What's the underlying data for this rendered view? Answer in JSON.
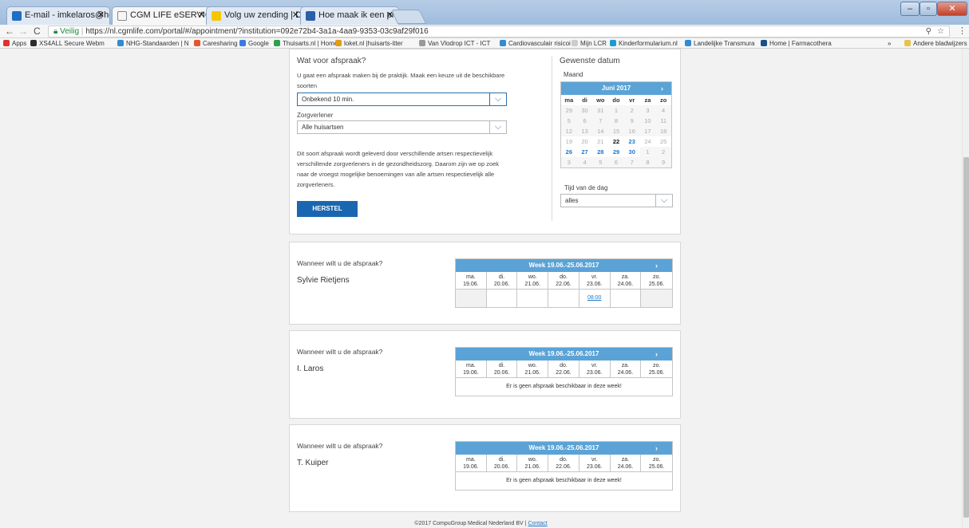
{
  "browser": {
    "tabs": [
      {
        "title": "E-mail - imkelaros@hotr",
        "color": "#1e6fc4"
      },
      {
        "title": "CGM LIFE eSERVICES",
        "color": "#888888"
      },
      {
        "title": "Volg uw zending | DHL F",
        "color": "#f6c700"
      },
      {
        "title": "Hoe maak ik een printsc",
        "color": "#2a5ea8"
      }
    ],
    "secure_label": "Veilig",
    "url": "https://nl.cgmlife.com/portal/#/appointment/?institution=092e72b4-3a1a-4aa9-9353-03c9af29f016",
    "bookmarks": [
      {
        "label": "Apps",
        "color": "#d33"
      },
      {
        "label": "XS4ALL Secure Webm",
        "color": "#2d2d2d"
      },
      {
        "label": "NHG-Standaarden | N",
        "color": "#2e8bd6"
      },
      {
        "label": "Caresharing",
        "color": "#e4572e"
      },
      {
        "label": "Google",
        "color": "#3b7be0"
      },
      {
        "label": "Thuisarts.nl | Home",
        "color": "#2aa24c"
      },
      {
        "label": "loket.nl |huisarts-itter",
        "color": "#e29c16"
      },
      {
        "label": "Van Vlodrop ICT - ICT",
        "color": "#999999"
      },
      {
        "label": "Cardiovasculair risicoi",
        "color": "#2e8bd6"
      },
      {
        "label": "Mijn LCR",
        "color": "#cccccc"
      },
      {
        "label": "Kinderformularium.nl",
        "color": "#1a9bd8"
      },
      {
        "label": "Landelijke Transmura",
        "color": "#2e8bd6"
      },
      {
        "label": "Home | Farmacothera",
        "color": "#1a4f8a"
      },
      {
        "label": "»",
        "color": ""
      },
      {
        "label": "Andere bladwijzers",
        "color": "#e8c24a"
      }
    ]
  },
  "form": {
    "title": "Wat voor afspraak?",
    "intro": "U gaat een afspraak maken bij de praktijk. Maak een keuze uit de beschikbare soorten",
    "type_value": "Onbekend 10 min.",
    "provider_label": "Zorgverlener",
    "provider_value": "Alle huisartsen",
    "description": "Dit soort afspraak wordt geleverd door verschillende artsen respectievelijk verschillende zorgverleners in de gezondheidszorg. Daarom zijn we op zoek naar de vroegst mogelijke benoemingen van alle artsen respectievelijk alle zorgverleners.",
    "reset_label": "HERSTEL"
  },
  "date": {
    "title": "Gewenste datum",
    "month_label": "Maand",
    "month_value": "Juni 2017",
    "next_arrow": "›",
    "weekdays": [
      "ma",
      "di",
      "wo",
      "do",
      "vr",
      "za",
      "zo"
    ],
    "days": [
      {
        "d": "29",
        "s": "out"
      },
      {
        "d": "30",
        "s": "out"
      },
      {
        "d": "31",
        "s": "out"
      },
      {
        "d": "1",
        "s": "past"
      },
      {
        "d": "2",
        "s": "past"
      },
      {
        "d": "3",
        "s": "past"
      },
      {
        "d": "4",
        "s": "past"
      },
      {
        "d": "5",
        "s": "past"
      },
      {
        "d": "6",
        "s": "past"
      },
      {
        "d": "7",
        "s": "past"
      },
      {
        "d": "8",
        "s": "past"
      },
      {
        "d": "9",
        "s": "past"
      },
      {
        "d": "10",
        "s": "past"
      },
      {
        "d": "11",
        "s": "past"
      },
      {
        "d": "12",
        "s": "past"
      },
      {
        "d": "13",
        "s": "past"
      },
      {
        "d": "14",
        "s": "past"
      },
      {
        "d": "15",
        "s": "past"
      },
      {
        "d": "16",
        "s": "past"
      },
      {
        "d": "17",
        "s": "past"
      },
      {
        "d": "18",
        "s": "past"
      },
      {
        "d": "19",
        "s": "cur"
      },
      {
        "d": "20",
        "s": "cur"
      },
      {
        "d": "21",
        "s": "cur"
      },
      {
        "d": "22",
        "s": "today"
      },
      {
        "d": "23",
        "s": "avail"
      },
      {
        "d": "24",
        "s": "cur"
      },
      {
        "d": "25",
        "s": "cur"
      },
      {
        "d": "26",
        "s": "avail"
      },
      {
        "d": "27",
        "s": "avail"
      },
      {
        "d": "28",
        "s": "avail"
      },
      {
        "d": "29",
        "s": "avail"
      },
      {
        "d": "30",
        "s": "avail"
      },
      {
        "d": "1",
        "s": "out"
      },
      {
        "d": "2",
        "s": "out"
      },
      {
        "d": "3",
        "s": "out"
      },
      {
        "d": "4",
        "s": "out"
      },
      {
        "d": "5",
        "s": "out"
      },
      {
        "d": "6",
        "s": "out"
      },
      {
        "d": "7",
        "s": "out"
      },
      {
        "d": "8",
        "s": "out"
      },
      {
        "d": "9",
        "s": "out"
      }
    ],
    "time_label": "Tijd van de dag",
    "time_value": "alles"
  },
  "week": {
    "label": "Week 19.06.-25.06.2017",
    "arrow": "›",
    "days": [
      {
        "wd": "ma.",
        "date": "19.06."
      },
      {
        "wd": "di.",
        "date": "20.06."
      },
      {
        "wd": "wo.",
        "date": "21.06."
      },
      {
        "wd": "do.",
        "date": "22.06."
      },
      {
        "wd": "vr.",
        "date": "23.06."
      },
      {
        "wd": "za.",
        "date": "24.06."
      },
      {
        "wd": "zo.",
        "date": "25.06."
      }
    ]
  },
  "providers": [
    {
      "question": "Wanneer wilt u de afspraak?",
      "name": "Sylvie Rietjens",
      "slot_time": "08:00",
      "empty_msg": ""
    },
    {
      "question": "Wanneer wilt u de afspraak?",
      "name": "I. Laros",
      "slot_time": "",
      "empty_msg": "Er is geen afspraak beschikbaar in deze week!"
    },
    {
      "question": "Wanneer wilt u de afspraak?",
      "name": "T. Kuiper",
      "slot_time": "",
      "empty_msg": "Er is geen afspraak beschikbaar in deze week!"
    }
  ],
  "footer": {
    "copyright": "©2017 CompuGroup Medical Nederland BV  |",
    "contact": "Contact"
  },
  "colors": {
    "accent": "#1a67b1",
    "calendar_header": "#5ba3d6",
    "available": "#1d78c7"
  }
}
